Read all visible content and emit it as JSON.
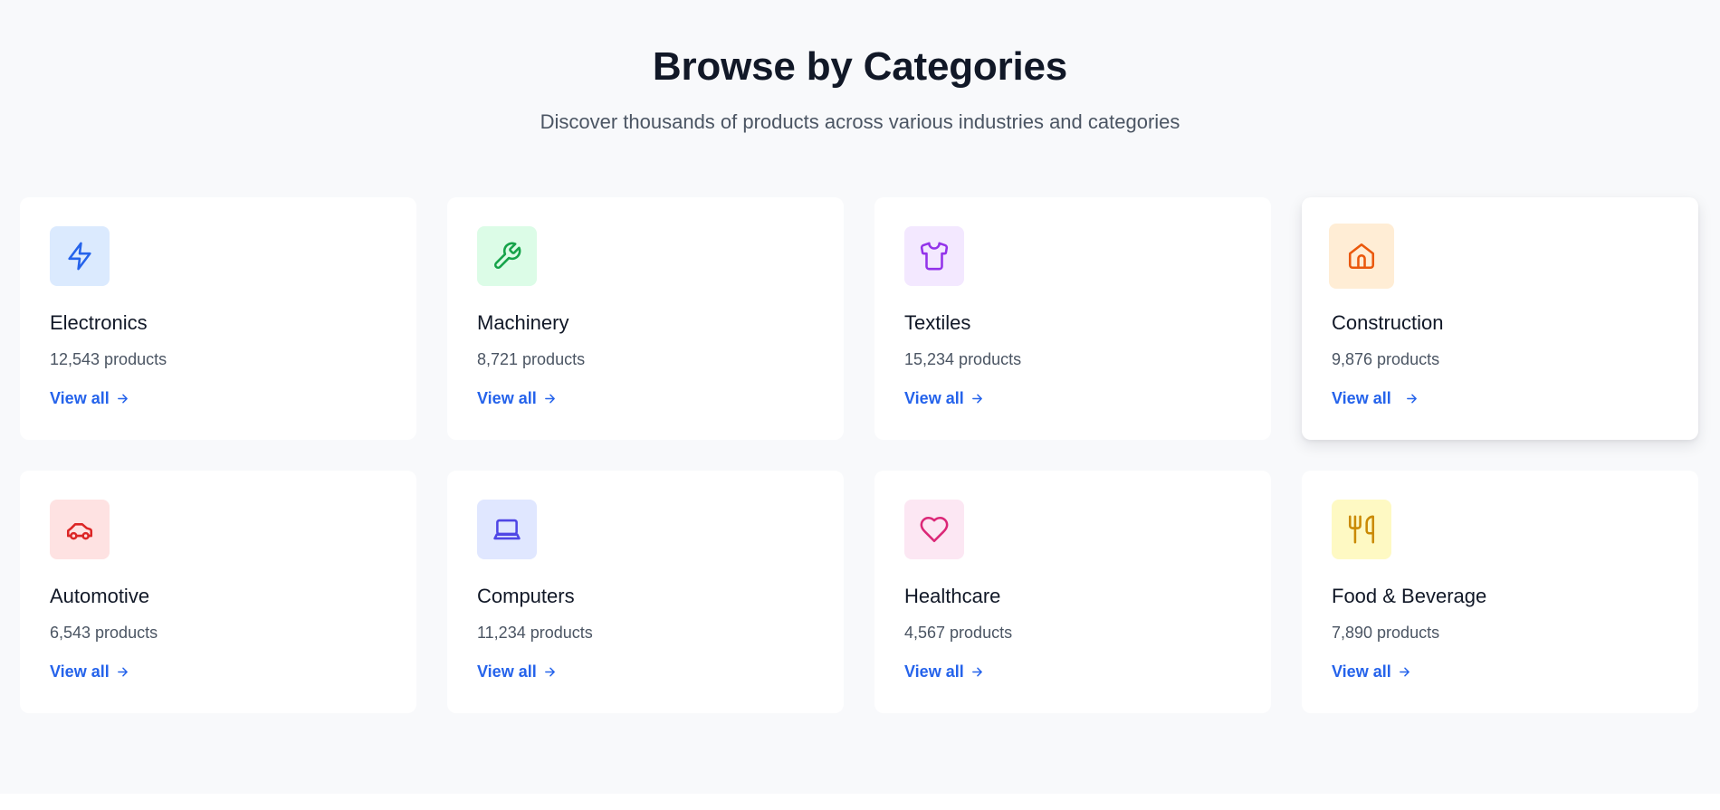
{
  "section": {
    "title": "Browse by Categories",
    "subtitle": "Discover thousands of products across various industries and categories"
  },
  "categories": [
    {
      "name": "Electronics",
      "count": "12,543 products",
      "link": "View all",
      "icon": "lightning-icon",
      "icon_color": "#2563eb",
      "icon_bg": "#dbeafe"
    },
    {
      "name": "Machinery",
      "count": "8,721 products",
      "link": "View all",
      "icon": "wrench-icon",
      "icon_color": "#16a34a",
      "icon_bg": "#dcfce7"
    },
    {
      "name": "Textiles",
      "count": "15,234 products",
      "link": "View all",
      "icon": "shirt-icon",
      "icon_color": "#9333ea",
      "icon_bg": "#f3e8ff"
    },
    {
      "name": "Construction",
      "count": "9,876 products",
      "link": "View all",
      "icon": "home-icon",
      "icon_color": "#ea580c",
      "icon_bg": "#ffedd5"
    },
    {
      "name": "Automotive",
      "count": "6,543 products",
      "link": "View all",
      "icon": "car-icon",
      "icon_color": "#dc2626",
      "icon_bg": "#fee2e2"
    },
    {
      "name": "Computers",
      "count": "11,234 products",
      "link": "View all",
      "icon": "laptop-icon",
      "icon_color": "#4f46e5",
      "icon_bg": "#e0e7ff"
    },
    {
      "name": "Healthcare",
      "count": "4,567 products",
      "link": "View all",
      "icon": "heart-icon",
      "icon_color": "#db2777",
      "icon_bg": "#fce7f3"
    },
    {
      "name": "Food & Beverage",
      "count": "7,890 products",
      "link": "View all",
      "icon": "utensils-icon",
      "icon_color": "#ca8a04",
      "icon_bg": "#fef9c3"
    }
  ],
  "colors": {
    "accent": "#2563eb",
    "heading": "#111827",
    "muted": "#4b5563",
    "background": "#f8f9fb"
  }
}
